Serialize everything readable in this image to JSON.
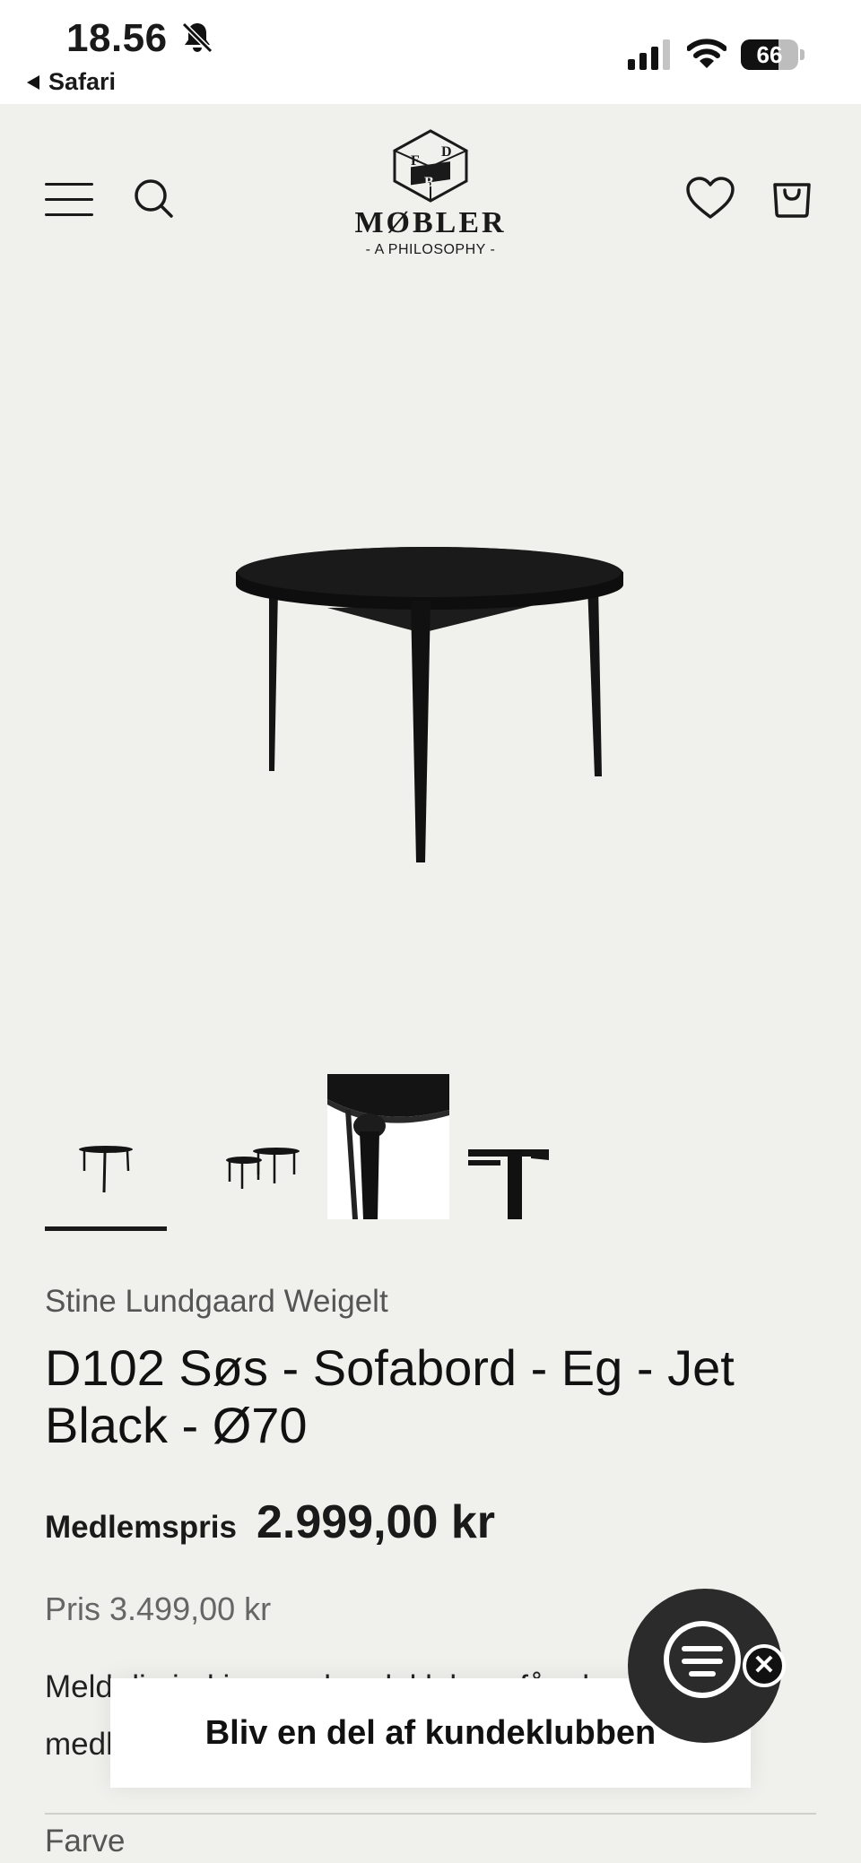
{
  "status_bar": {
    "time": "18.56",
    "back_app": "Safari",
    "battery": "66",
    "battery_level": 0.66,
    "icons": [
      "bell-slash-icon",
      "cellular-signal-icon",
      "wifi-icon",
      "battery-icon"
    ]
  },
  "header": {
    "logo_initials": [
      "F",
      "D",
      "B"
    ],
    "logo_word": "MØBLER",
    "logo_tagline": "- A PHILOSOPHY -",
    "icons": [
      "menu-icon",
      "search-icon",
      "heart-icon",
      "shopping-bag-icon"
    ]
  },
  "gallery": {
    "thumbnail_count": 4,
    "active_index": 0
  },
  "product": {
    "designer": "Stine Lundgaard Weigelt",
    "title": "D102 Søs - Sofabord - Eg - Jet Black - Ø70",
    "member_label": "Medlemspris",
    "member_price": "2.999,00 kr",
    "regular_price": "Pris 3.499,00 kr",
    "club_text": "Meld dig ind i vores kundeklub og få adgang til medlemspriser",
    "color_label": "Farve"
  },
  "popup": {
    "banner_label": "Bliv en del af kundeklubben",
    "close_symbol": "✕"
  },
  "colors": {
    "background": "#f0f0ec",
    "text": "#1a1a1a",
    "product_black": "#141414"
  }
}
